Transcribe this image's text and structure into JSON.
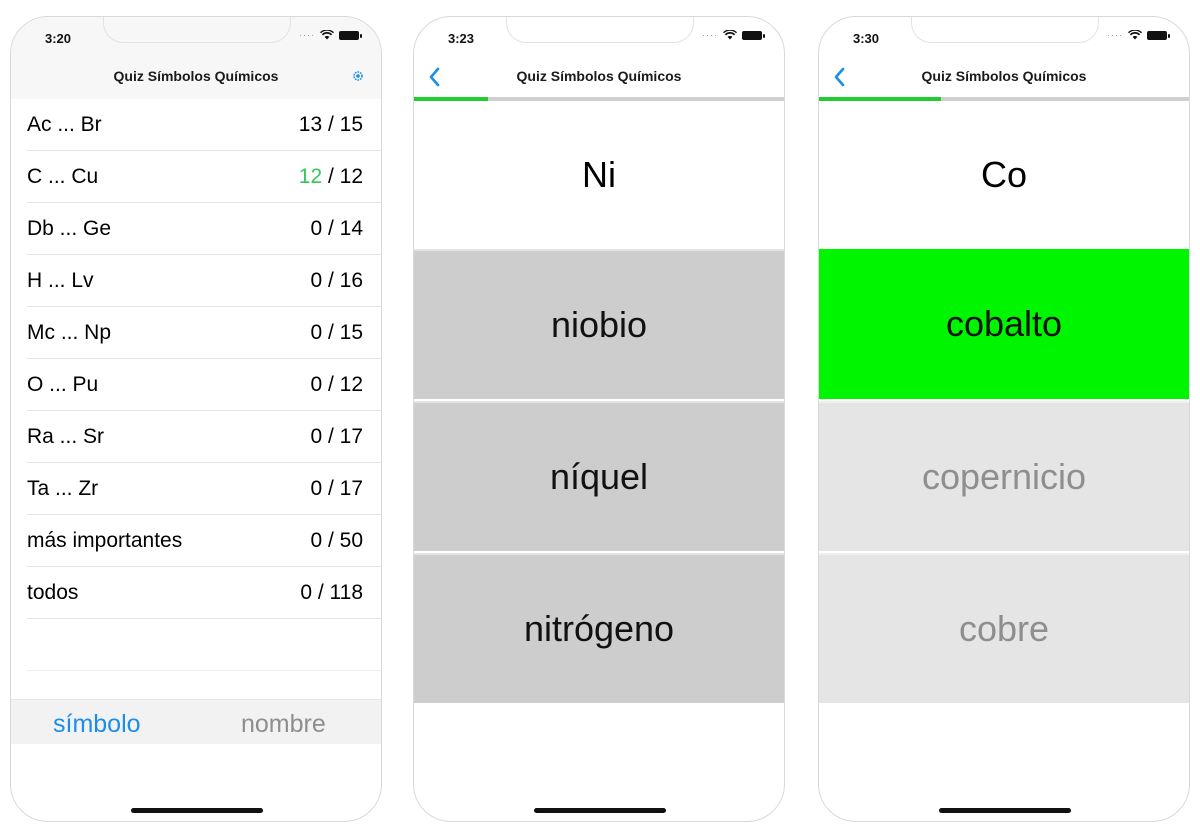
{
  "colors": {
    "progress": "#20cc30",
    "accent_blue": "#1a8ee8",
    "correct_green": "#00f500",
    "score_green": "#34c759"
  },
  "screens": [
    {
      "time": "3:20",
      "title": "Quiz Símbolos Químicos",
      "rows": [
        {
          "label": "Ac ... Br",
          "correct": "13",
          "total": "15"
        },
        {
          "label": "C ... Cu",
          "correct": "12",
          "total": "12"
        },
        {
          "label": "Db ... Ge",
          "correct": "0",
          "total": "14"
        },
        {
          "label": "H ... Lv",
          "correct": "0",
          "total": "16"
        },
        {
          "label": "Mc ... Np",
          "correct": "0",
          "total": "15"
        },
        {
          "label": "O ... Pu",
          "correct": "0",
          "total": "12"
        },
        {
          "label": "Ra ... Sr",
          "correct": "0",
          "total": "17"
        },
        {
          "label": "Ta ... Zr",
          "correct": "0",
          "total": "17"
        },
        {
          "label": "más importantes",
          "correct": "0",
          "total": "50"
        },
        {
          "label": "todos",
          "correct": "0",
          "total": "118"
        }
      ],
      "segments": [
        "símbolo",
        "nombre"
      ]
    },
    {
      "time": "3:23",
      "title": "Quiz Símbolos Químicos",
      "progress": 0.2,
      "question": "Ni",
      "answers": [
        "niobio",
        "níquel",
        "nitrógeno"
      ]
    },
    {
      "time": "3:30",
      "title": "Quiz Símbolos Químicos",
      "progress": 0.33,
      "question": "Co",
      "answers": [
        "cobalto",
        "copernicio",
        "cobre"
      ]
    }
  ]
}
